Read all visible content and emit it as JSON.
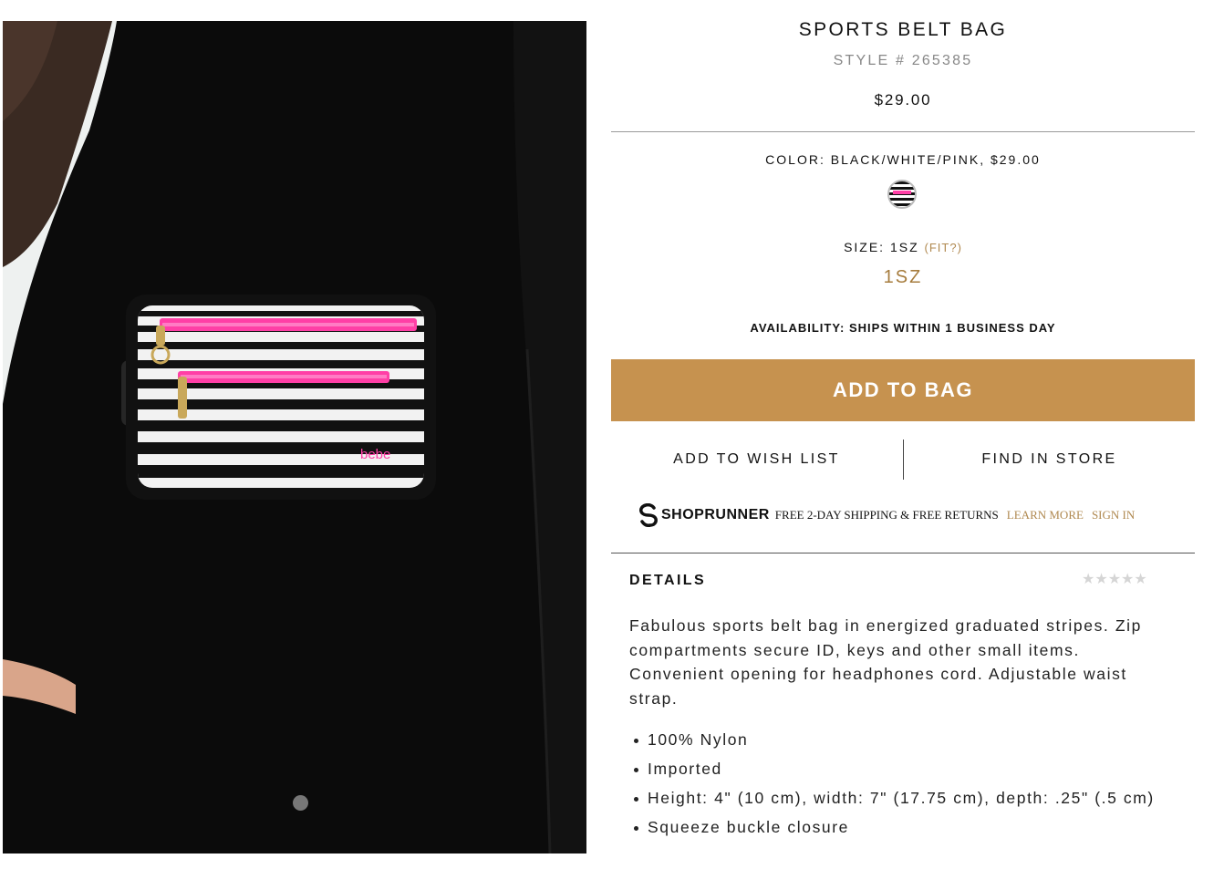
{
  "product": {
    "title": "SPORTS BELT BAG",
    "style_number": "STYLE # 265385",
    "price": "$29.00"
  },
  "color": {
    "label": "COLOR: BLACK/WHITE/PINK, $29.00",
    "swatch_icon": "striped-swatch-icon"
  },
  "size": {
    "label": "SIZE: 1SZ",
    "fit_link": "(FIT?)",
    "selected": "1SZ"
  },
  "availability": "AVAILABILITY: SHIPS WITHIN 1 BUSINESS DAY",
  "buttons": {
    "add_to_bag": "ADD TO BAG",
    "wish_list": "ADD TO WISH LIST",
    "find_in_store": "FIND IN STORE"
  },
  "shoprunner": {
    "brand": "SHOPRUNNER",
    "offer": "FREE 2-DAY SHIPPING & FREE RETURNS",
    "learn_more": "LEARN MORE",
    "sign_in": "SIGN IN"
  },
  "details": {
    "heading": "DETAILS",
    "rating_stars": "★★★★★",
    "description": "Fabulous sports belt bag in energized graduated stripes. Zip compartments secure ID, keys and other small items. Convenient opening for headphones cord. Adjustable waist strap.",
    "bullets": [
      "100% Nylon",
      "Imported",
      "Height: 4\" (10 cm), width: 7\" (17.75 cm), depth: .25\" (.5 cm)",
      "Squeeze buckle closure"
    ]
  },
  "image": {
    "brand_mark": "bebe"
  },
  "colors": {
    "accent": "#c6924f",
    "link": "#b08950",
    "zipper_pink": "#ff3fa6"
  }
}
